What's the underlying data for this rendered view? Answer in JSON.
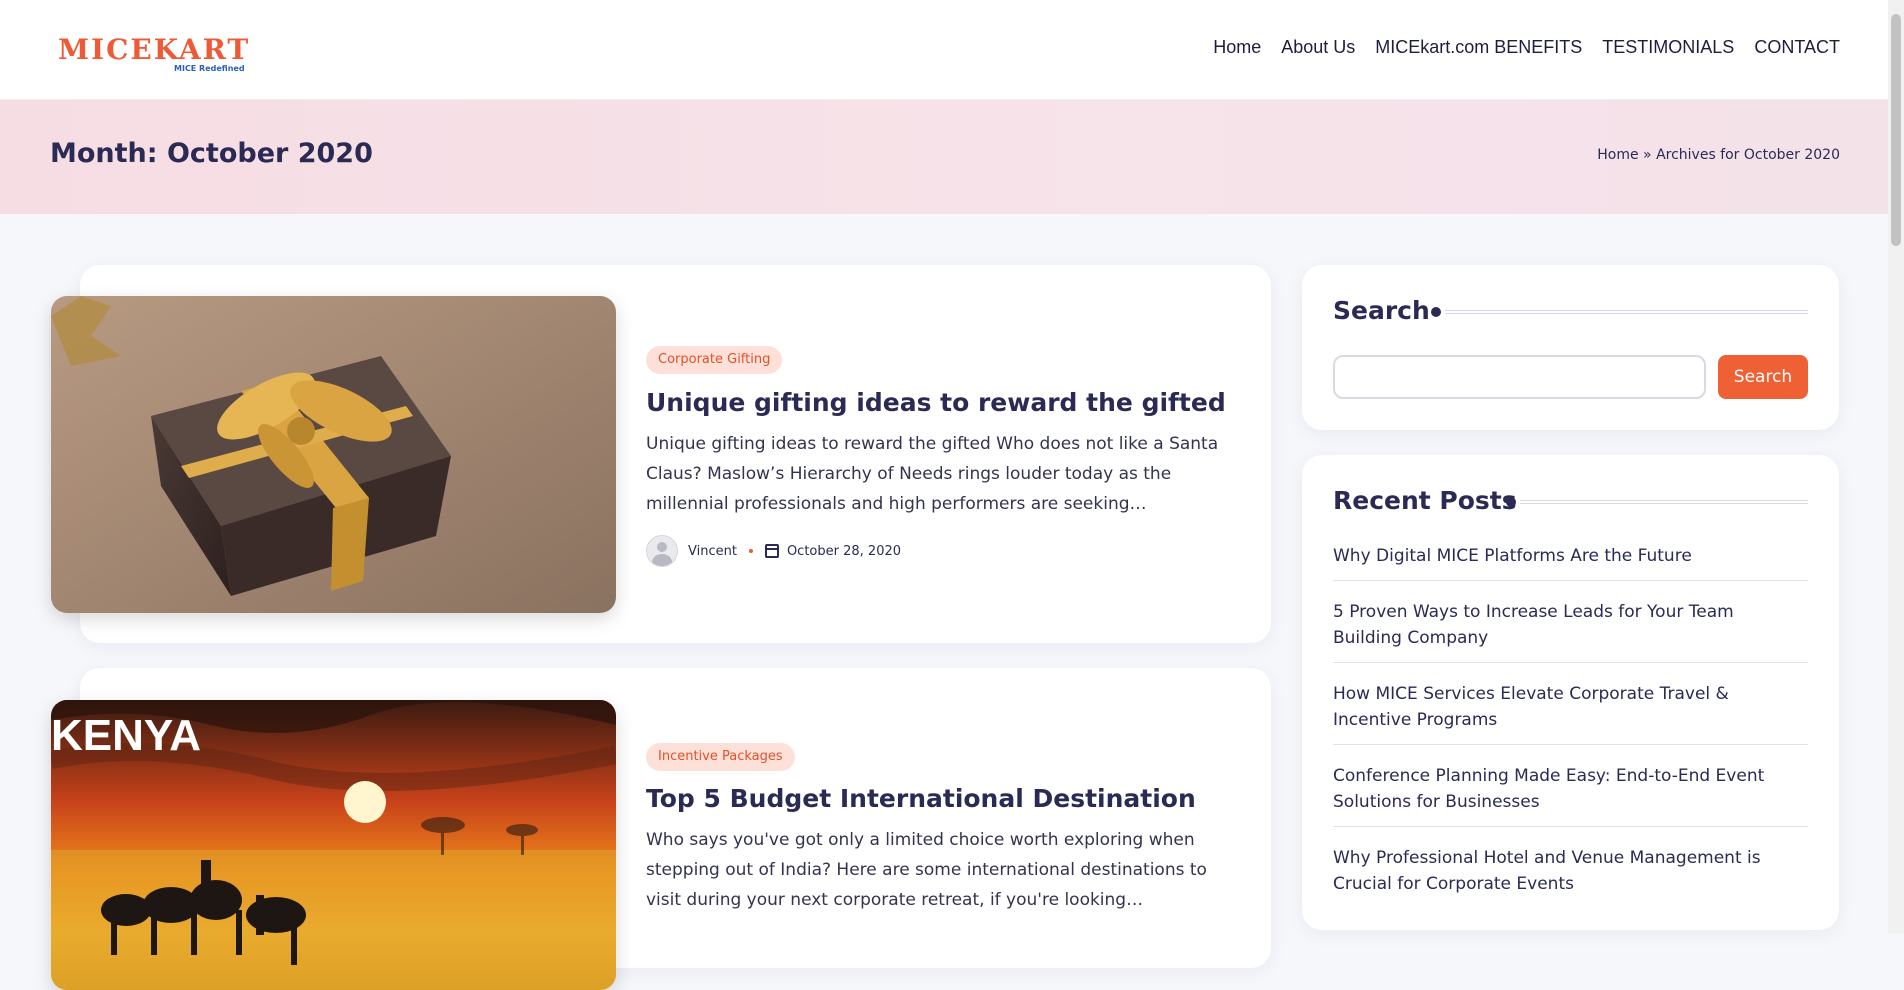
{
  "header": {
    "logo": {
      "brand": "MICEKART",
      "tagline": "MICE Redefined"
    },
    "nav": [
      "Home",
      "About Us",
      "MICEkart.com BENEFITS",
      "TESTIMONIALS",
      "CONTACT"
    ]
  },
  "page": {
    "title": "Month: October 2020",
    "breadcrumb": {
      "home": "Home",
      "separator": "»",
      "current": "Archives for October 2020"
    }
  },
  "posts": [
    {
      "category": "Corporate Gifting",
      "title": "Unique gifting ideas to reward the gifted",
      "excerpt": "Unique gifting ideas to reward the gifted Who does not like a Santa Claus?  Maslow’s Hierarchy of Needs rings louder today as the millennial professionals and high performers are seeking…",
      "author": "Vincent",
      "date": "October 28, 2020",
      "image_icon": "gift-box-image"
    },
    {
      "category": "Incentive Packages",
      "title": "Top 5 Budget International Destination",
      "excerpt": "Who says you've got only a limited choice worth exploring when stepping out of India? Here are some international destinations to visit during your next corporate retreat, if you're looking…",
      "image_text": "KENYA",
      "image_icon": "kenya-sunset-image"
    }
  ],
  "sidebar": {
    "search": {
      "heading": "Search",
      "button": "Search",
      "value": ""
    },
    "recent": {
      "heading": "Recent Posts",
      "items": [
        "Why Digital MICE Platforms Are the Future",
        "5 Proven Ways to Increase Leads for Your Team Building Company",
        "How MICE Services Elevate Corporate Travel & Incentive Programs",
        "Conference Planning Made Easy: End-to-End Event Solutions for Businesses",
        "Why Professional Hotel and Venue Management is Crucial for Corporate Events"
      ]
    }
  },
  "colors": {
    "accent": "#ef6034",
    "heading": "#2a2a55",
    "badge_bg": "#fde1d8",
    "band": "#f6dde3"
  }
}
